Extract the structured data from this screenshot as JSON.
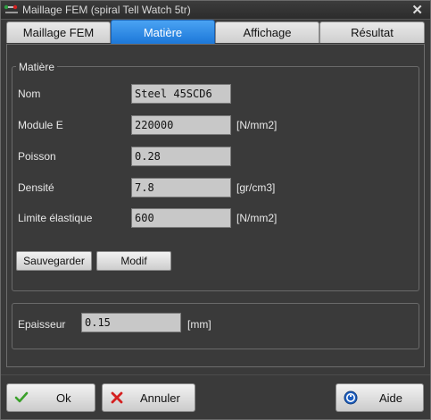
{
  "window": {
    "title": "Maillage FEM (spiral Tell Watch 5tr)",
    "close_glyph": "✕"
  },
  "tabs": [
    {
      "label": "Maillage FEM",
      "active": false
    },
    {
      "label": "Matière",
      "active": true
    },
    {
      "label": "Affichage",
      "active": false
    },
    {
      "label": "Résultat",
      "active": false
    }
  ],
  "material_group": {
    "title": "Matière",
    "fields": [
      {
        "label": "Nom",
        "value": "Steel 45SCD6",
        "unit": ""
      },
      {
        "label": "Module E",
        "value": "220000",
        "unit": "[N/mm2]"
      },
      {
        "label": "Poisson",
        "value": "0.28",
        "unit": ""
      },
      {
        "label": "Densité",
        "value": "7.8",
        "unit": "[gr/cm3]"
      },
      {
        "label": "Limite élastique",
        "value": "600",
        "unit": "[N/mm2]"
      }
    ],
    "save_label": "Sauvegarder",
    "modify_label": "Modif"
  },
  "thickness": {
    "label": "Epaisseur",
    "value": "0.15",
    "unit": "[mm]"
  },
  "footer": {
    "ok_label": "Ok",
    "cancel_label": "Annuler",
    "help_label": "Aide"
  },
  "icons": {
    "app": "app-mesh-icon",
    "ok": "check-icon",
    "cancel": "cross-icon",
    "help": "help-icon"
  },
  "colors": {
    "accent_tab": "#1c77d8",
    "ok_check": "#3aa02a",
    "cancel_cross": "#d42020",
    "help_blue": "#1e5fc0"
  }
}
